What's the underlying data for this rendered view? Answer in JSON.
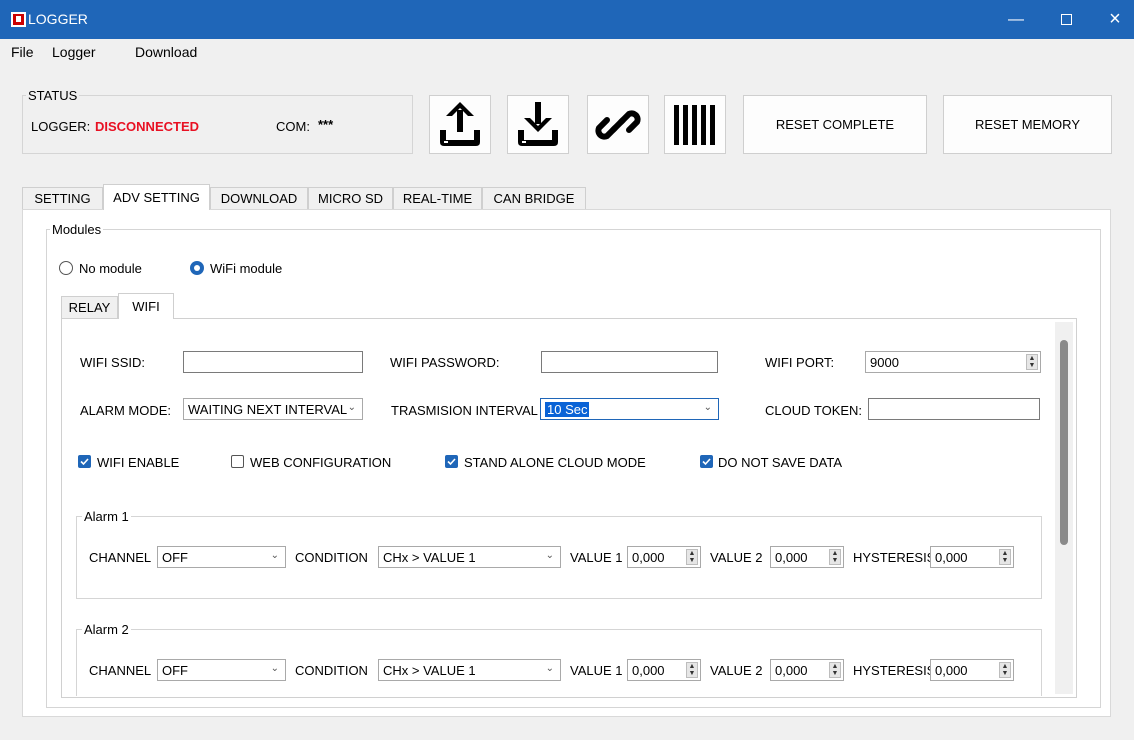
{
  "window": {
    "title": "LOGGER"
  },
  "menu": [
    "File",
    "Logger",
    "Download"
  ],
  "status": {
    "group_title": "STATUS",
    "logger_label": "LOGGER:",
    "logger_value": "DISCONNECTED",
    "com_label": "COM:",
    "com_value": "***",
    "reset_complete": "RESET COMPLETE",
    "reset_memory": "RESET MEMORY"
  },
  "tabs": [
    "SETTING",
    "ADV SETTING",
    "DOWNLOAD",
    "MICRO SD",
    "REAL-TIME",
    "CAN BRIDGE"
  ],
  "modules": {
    "title": "Modules",
    "no_module": "No module",
    "wifi_module": "WiFi module",
    "subtabs": [
      "RELAY",
      "WIFI"
    ]
  },
  "wifi": {
    "ssid_label": "WIFI  SSID:",
    "ssid_value": "",
    "password_label": "WIFI  PASSWORD:",
    "password_value": "",
    "port_label": "WIFI  PORT:",
    "port_value": "9000",
    "alarm_mode_label": "ALARM MODE:",
    "alarm_mode_value": "WAITING NEXT INTERVAL",
    "interval_label": "TRASMISION INTERVAL",
    "interval_value": "10 Sec",
    "cloud_token_label": "CLOUD TOKEN:",
    "cloud_token_value": "",
    "checkboxes": {
      "wifi_enable": "WIFI ENABLE",
      "web_config": "WEB CONFIGURATION",
      "standalone": "STAND ALONE CLOUD MODE",
      "no_save": "DO NOT SAVE DATA"
    }
  },
  "alarms": [
    {
      "title": "Alarm 1",
      "channel_label": "CHANNEL",
      "channel": "OFF",
      "condition_label": "CONDITION",
      "condition": "CHx > VALUE 1",
      "value1_label": "VALUE 1",
      "value1": "0,000",
      "value2_label": "VALUE 2",
      "value2": "0,000",
      "hyst_label": "HYSTERESIS",
      "hyst": "0,000"
    },
    {
      "title": "Alarm 2",
      "channel_label": "CHANNEL",
      "channel": "OFF",
      "condition_label": "CONDITION",
      "condition": "CHx > VALUE 1",
      "value1_label": "VALUE 1",
      "value1": "0,000",
      "value2_label": "VALUE 2",
      "value2": "0,000",
      "hyst_label": "HYSTERESIS",
      "hyst": "0,000"
    }
  ],
  "colors": {
    "accent": "#1f66b8",
    "error": "#e81123"
  }
}
